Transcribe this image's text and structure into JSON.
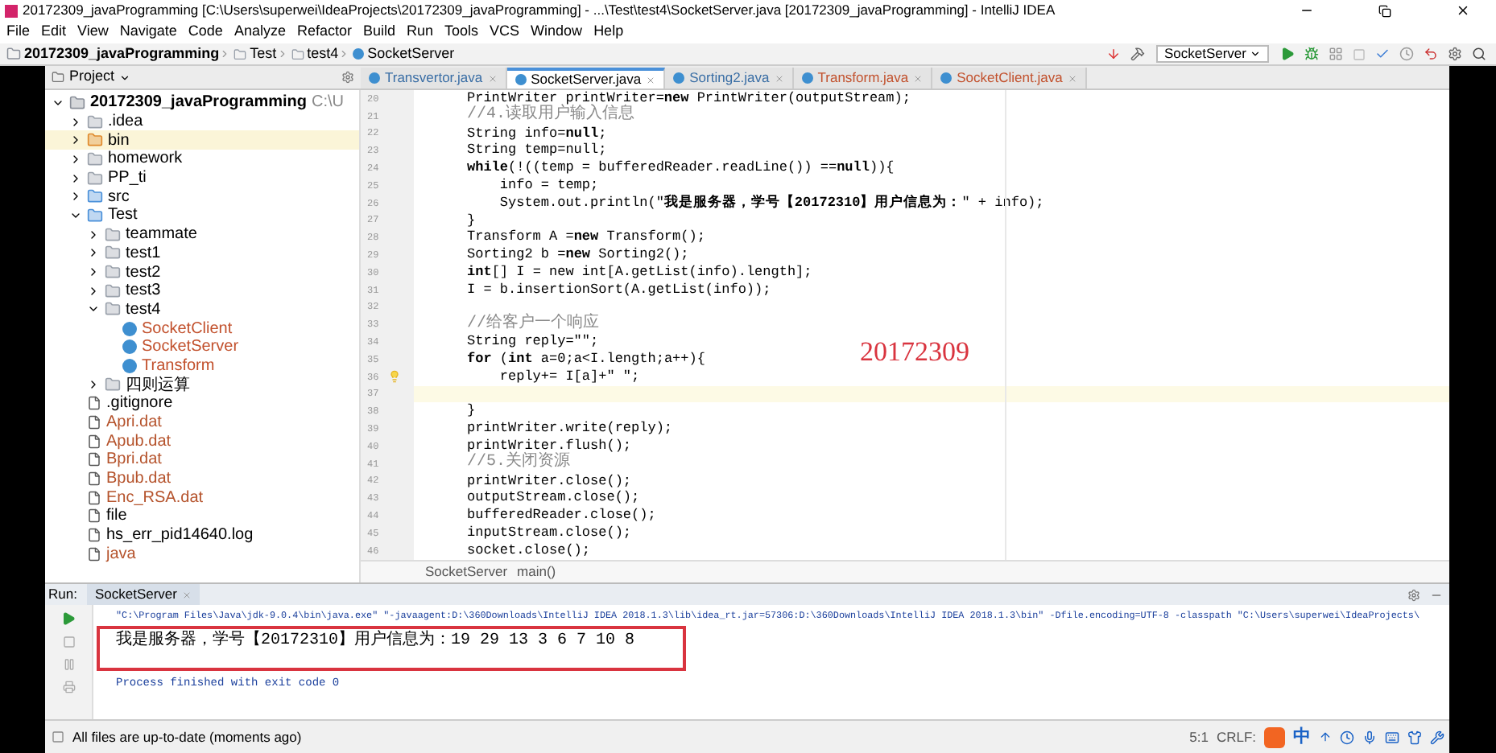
{
  "window": {
    "title": "20172309_javaProgramming [C:\\Users\\superwei\\IdeaProjects\\20172309_javaProgramming] - ...\\Test\\test4\\SocketServer.java [20172309_javaProgramming] - IntelliJ IDEA"
  },
  "menu": [
    "File",
    "Edit",
    "View",
    "Navigate",
    "Code",
    "Analyze",
    "Refactor",
    "Build",
    "Run",
    "Tools",
    "VCS",
    "Window",
    "Help"
  ],
  "breadcrumb": [
    "20172309_javaProgramming",
    "Test",
    "test4",
    "SocketServer"
  ],
  "run_config": "SocketServer",
  "project_panel": {
    "title": "Project",
    "tree": [
      {
        "name": "20172309_javaProgramming",
        "path": "C:\\U",
        "kind": "module",
        "expanded": true,
        "selected": false,
        "color": "#000000",
        "children": [
          {
            "name": ".idea",
            "kind": "folder",
            "expanded": false,
            "selected": false,
            "color": "#000000"
          },
          {
            "name": "bin",
            "kind": "excluded-folder",
            "expanded": false,
            "selected": true,
            "color": "#000000"
          },
          {
            "name": "homework",
            "kind": "folder",
            "expanded": false,
            "selected": false,
            "color": "#000000"
          },
          {
            "name": "PP_ti",
            "kind": "folder",
            "expanded": false,
            "selected": false,
            "color": "#000000"
          },
          {
            "name": "src",
            "kind": "source-folder",
            "expanded": false,
            "selected": false,
            "color": "#000000"
          },
          {
            "name": "Test",
            "kind": "source-folder",
            "expanded": true,
            "selected": false,
            "color": "#000000",
            "children": [
              {
                "name": "teammate",
                "kind": "package",
                "expanded": false,
                "selected": false,
                "color": "#000000"
              },
              {
                "name": "test1",
                "kind": "package",
                "expanded": false,
                "selected": false,
                "color": "#000000"
              },
              {
                "name": "test2",
                "kind": "package",
                "expanded": false,
                "selected": false,
                "color": "#000000"
              },
              {
                "name": "test3",
                "kind": "package",
                "expanded": false,
                "selected": false,
                "color": "#000000"
              },
              {
                "name": "test4",
                "kind": "package",
                "expanded": true,
                "selected": false,
                "color": "#000000",
                "children": [
                  {
                    "name": "SocketClient",
                    "kind": "class",
                    "selected": false,
                    "color": "#c2512d"
                  },
                  {
                    "name": "SocketServer",
                    "kind": "class",
                    "selected": false,
                    "color": "#c2512d"
                  },
                  {
                    "name": "Transform",
                    "kind": "class",
                    "selected": false,
                    "color": "#c2512d"
                  }
                ]
              },
              {
                "name": "四则运算",
                "kind": "package",
                "expanded": false,
                "selected": false,
                "color": "#000000"
              }
            ]
          },
          {
            "name": ".gitignore",
            "kind": "file",
            "selected": false,
            "color": "#000000"
          },
          {
            "name": "Apri.dat",
            "kind": "file",
            "selected": false,
            "color": "#b5532c"
          },
          {
            "name": "Apub.dat",
            "kind": "file",
            "selected": false,
            "color": "#b5532c"
          },
          {
            "name": "Bpri.dat",
            "kind": "file",
            "selected": false,
            "color": "#b5532c"
          },
          {
            "name": "Bpub.dat",
            "kind": "file",
            "selected": false,
            "color": "#b5532c"
          },
          {
            "name": "Enc_RSA.dat",
            "kind": "file",
            "selected": false,
            "color": "#b5532c"
          },
          {
            "name": "file",
            "kind": "file",
            "selected": false,
            "color": "#000000"
          },
          {
            "name": "hs_err_pid14640.log",
            "kind": "file",
            "selected": false,
            "color": "#000000"
          },
          {
            "name": "java",
            "kind": "file",
            "selected": false,
            "color": "#b5532c"
          }
        ]
      }
    ]
  },
  "tabs": [
    {
      "label": "Transvertor.java",
      "selected": false,
      "color": "#3a6ea5"
    },
    {
      "label": "SocketServer.java",
      "selected": true,
      "color": "#000000"
    },
    {
      "label": "Sorting2.java",
      "selected": false,
      "color": "#3a6ea5"
    },
    {
      "label": "Transform.java",
      "selected": false,
      "color": "#c2512d"
    },
    {
      "label": "SocketClient.java",
      "selected": false,
      "color": "#c2512d"
    }
  ],
  "editor": {
    "lines": [
      {
        "number": "20",
        "kind": "code",
        "text": "PrintWriter printWriter=**new** PrintWriter(outputStream);",
        "current": false,
        "bulb": false
      },
      {
        "number": "21",
        "kind": "comment",
        "text": "//4.读取用户输入信息",
        "current": false,
        "bulb": false
      },
      {
        "number": "22",
        "kind": "code",
        "text": "String info=**null**;",
        "current": false,
        "bulb": false
      },
      {
        "number": "23",
        "kind": "code",
        "text": "String temp=null;",
        "current": false,
        "bulb": false
      },
      {
        "number": "24",
        "kind": "code",
        "text": "**while**(!((temp = bufferedReader.readLine()) ==**null**)){",
        "current": false,
        "bulb": false
      },
      {
        "number": "25",
        "kind": "code",
        "text": "    info = temp;",
        "current": false,
        "bulb": false
      },
      {
        "number": "26",
        "kind": "code",
        "text": "    System.out.println(\"**我是服务器，学号【20172310】用户信息为：**\" + info);",
        "current": false,
        "bulb": false
      },
      {
        "number": "27",
        "kind": "code",
        "text": "}",
        "current": false,
        "bulb": false
      },
      {
        "number": "28",
        "kind": "code",
        "text": "Transform A =**new** Transform();",
        "current": false,
        "bulb": false
      },
      {
        "number": "29",
        "kind": "code",
        "text": "Sorting2 b =**new** Sorting2();",
        "current": false,
        "bulb": false
      },
      {
        "number": "30",
        "kind": "code",
        "text": "**int**[] I = new int[A.getList(info).length];",
        "current": false,
        "bulb": false
      },
      {
        "number": "31",
        "kind": "code",
        "text": "I = b.insertionSort(A.getList(info));",
        "current": false,
        "bulb": false
      },
      {
        "number": "32",
        "kind": "blank",
        "current": false,
        "bulb": false
      },
      {
        "number": "33",
        "kind": "comment",
        "text": "//给客户一个响应",
        "current": false,
        "bulb": false
      },
      {
        "number": "34",
        "kind": "code",
        "text": "String reply=\"\";",
        "current": false,
        "bulb": false
      },
      {
        "number": "35",
        "kind": "code",
        "text": "**for** (**int** a=0;a<I.length;a++){",
        "current": false,
        "bulb": false
      },
      {
        "number": "36",
        "kind": "code",
        "text": "    reply+= I[a]+\" \";",
        "current": false,
        "bulb": true
      },
      {
        "number": "37",
        "kind": "blank",
        "current": true,
        "bulb": false
      },
      {
        "number": "38",
        "kind": "code",
        "text": "}",
        "current": false,
        "bulb": false
      },
      {
        "number": "39",
        "kind": "code",
        "text": "printWriter.write(reply);",
        "current": false,
        "bulb": false
      },
      {
        "number": "40",
        "kind": "code",
        "text": "printWriter.flush();",
        "current": false,
        "bulb": false
      },
      {
        "number": "41",
        "kind": "comment",
        "text": "//5.关闭资源",
        "current": false,
        "bulb": false
      },
      {
        "number": "42",
        "kind": "code",
        "text": "printWriter.close();",
        "current": false,
        "bulb": false
      },
      {
        "number": "43",
        "kind": "code",
        "text": "outputStream.close();",
        "current": false,
        "bulb": false
      },
      {
        "number": "44",
        "kind": "code",
        "text": "bufferedReader.close();",
        "current": false,
        "bulb": false
      },
      {
        "number": "45",
        "kind": "code",
        "text": "inputStream.close();",
        "current": false,
        "bulb": false
      },
      {
        "number": "46",
        "kind": "code",
        "text": "socket.close();",
        "current": false,
        "bulb": false
      }
    ],
    "annotation": "20172309",
    "breadcrumb": [
      "SocketServer",
      "main()"
    ]
  },
  "run_panel": {
    "label": "Run:",
    "tab": "SocketServer",
    "console": [
      {
        "kind": "command",
        "text": "\"C:\\Program Files\\Java\\jdk-9.0.4\\bin\\java.exe\" \"-javaagent:D:\\360Downloads\\IntelliJ IDEA 2018.1.3\\lib\\idea_rt.jar=57306:D:\\360Downloads\\IntelliJ IDEA 2018.1.3\\bin\" -Dfile.encoding=UTF-8 -classpath \"C:\\Users\\superwei\\IdeaProjects\\"
      },
      {
        "kind": "highlighted",
        "text": "我是服务器，学号【20172310】用户信息为：19 29 13 3 6 7 10 8"
      },
      {
        "kind": "system",
        "text": "Process finished with exit code 0"
      }
    ]
  },
  "status_bar": {
    "message": "All files are up-to-date (moments ago)",
    "position": "5:1",
    "line_separator": "CRLF:",
    "ime": "中"
  }
}
